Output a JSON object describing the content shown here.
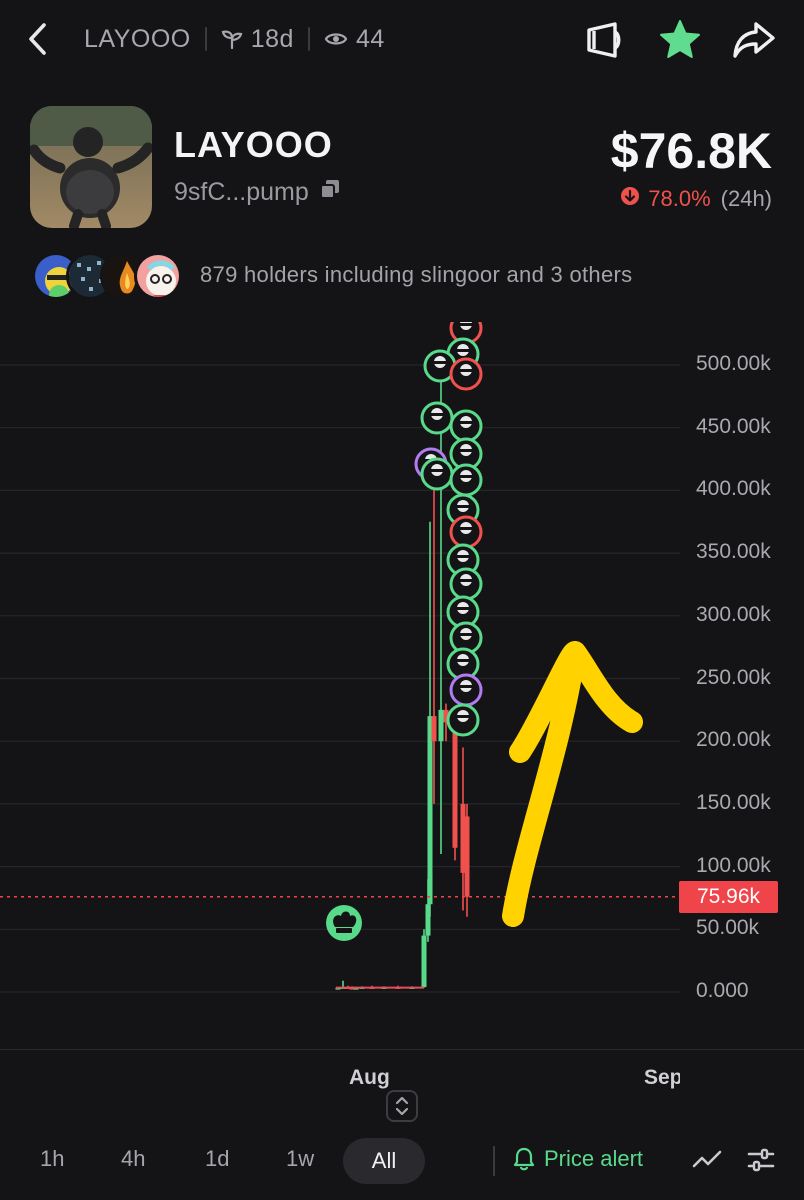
{
  "topbar": {
    "token": "LAYOOO",
    "age": "18d",
    "views": "44"
  },
  "token": {
    "name": "LAYOOO",
    "address": "9sfC...pump",
    "price": "$76.8K",
    "change_pct": "78.0%",
    "change_period": "(24h)"
  },
  "holders": {
    "text": "879 holders including slingoor and 3 others"
  },
  "chart": {
    "current_price_label": "75.96k",
    "x_labels": [
      "Aug",
      "Sep"
    ]
  },
  "timeframes": {
    "h1": "1h",
    "h4": "4h",
    "d1": "1d",
    "w1": "1w",
    "all": "All"
  },
  "price_alert": "Price alert",
  "colors": {
    "background": "#141416",
    "up": "#59d98a",
    "down": "#f0514d",
    "annotation": "#ffd200"
  },
  "chart_data": {
    "type": "candlestick",
    "title": "",
    "xlabel": "",
    "ylabel": "",
    "x_ticks": [
      "Aug",
      "Sep"
    ],
    "y_ticks": [
      "0.000",
      "50.00k",
      "100.00k",
      "150.00k",
      "200.00k",
      "250.00k",
      "300.00k",
      "350.00k",
      "400.00k",
      "450.00k",
      "500.00k"
    ],
    "ylim": [
      0,
      525000
    ],
    "current_value": 75960,
    "series": [
      {
        "values": [
          {
            "o": 3000,
            "h": 4000,
            "l": 2500,
            "c": 3500
          },
          {
            "o": 3500,
            "h": 9000,
            "l": 3000,
            "c": 4000
          },
          {
            "o": 4000,
            "h": 5000,
            "l": 3000,
            "c": 3500
          },
          {
            "o": 3500,
            "h": 4500,
            "l": 2500,
            "c": 3000
          },
          {
            "o": 3000,
            "h": 4000,
            "l": 2500,
            "c": 3500
          },
          {
            "o": 3500,
            "h": 4500,
            "l": 3000,
            "c": 4000
          },
          {
            "o": 4000,
            "h": 5000,
            "l": 3000,
            "c": 3500
          },
          {
            "o": 3500,
            "h": 4500,
            "l": 3000,
            "c": 4000
          },
          {
            "o": 4000,
            "h": 5000,
            "l": 3000,
            "c": 3500
          },
          {
            "o": 3500,
            "h": 4500,
            "l": 3000,
            "c": 4000
          },
          {
            "o": 4000,
            "h": 50000,
            "l": 3500,
            "c": 45000
          },
          {
            "o": 45000,
            "h": 90000,
            "l": 40000,
            "c": 70000
          },
          {
            "o": 70000,
            "h": 375000,
            "l": 60000,
            "c": 220000
          },
          {
            "o": 220000,
            "h": 420000,
            "l": 150000,
            "c": 200000
          },
          {
            "o": 200000,
            "h": 500000,
            "l": 110000,
            "c": 225000
          },
          {
            "o": 225000,
            "h": 230000,
            "l": 200000,
            "c": 215000
          },
          {
            "o": 215000,
            "h": 225000,
            "l": 105000,
            "c": 115000
          },
          {
            "o": 150000,
            "h": 195000,
            "l": 65000,
            "c": 95000
          },
          {
            "o": 140000,
            "h": 150000,
            "l": 60000,
            "c": 75960
          }
        ]
      }
    ]
  }
}
